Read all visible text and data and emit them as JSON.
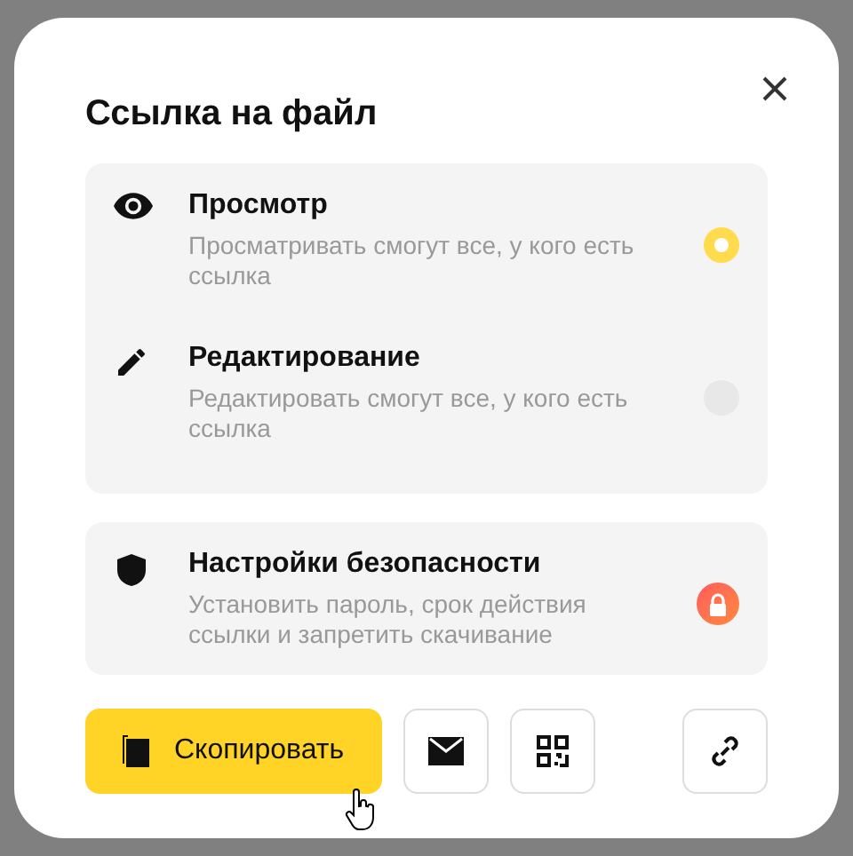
{
  "dialog": {
    "title": "Ссылка на файл"
  },
  "access_options": [
    {
      "kind": "view",
      "title": "Просмотр",
      "description": "Просматривать смогут все, у кого есть ссылка",
      "selected": true
    },
    {
      "kind": "edit",
      "title": "Редактирование",
      "description": "Редактировать смогут все, у кого есть ссылка",
      "selected": false
    }
  ],
  "security": {
    "title": "Настройки безопасности",
    "description": "Установить пароль, срок действия ссылки и запретить скачивание",
    "locked": true
  },
  "copy_button": {
    "label": "Скопировать"
  }
}
